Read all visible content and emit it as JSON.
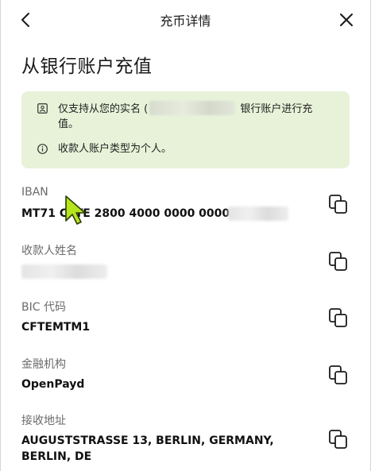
{
  "header": {
    "title": "充币详情",
    "back_icon": "chevron-left-icon",
    "close_icon": "close-icon"
  },
  "page": {
    "title": "从银行账户充值"
  },
  "notice": {
    "line1_prefix": "仅支持从您的实名 (",
    "line1_suffix": " 银行账户进行充",
    "line1_wrap": "值。",
    "line2": "收款人账户类型为个人。",
    "icon1": "id-card-icon",
    "icon2": "info-circle-icon",
    "background": "#e7f2d8"
  },
  "fields": [
    {
      "label": "IBAN",
      "value": "MT71 CFTE 2800 4000 0000 0000"
    },
    {
      "label": "收款人姓名",
      "value": ""
    },
    {
      "label": "BIC 代码",
      "value": "CFTEMTM1"
    },
    {
      "label": "金融机构",
      "value": "OpenPayd"
    },
    {
      "label": "接收地址",
      "value_line1": "AUGUSTSTRASSE 13, BERLIN, GERMANY,",
      "value_line2": "BERLIN, DE"
    }
  ],
  "icons": {
    "copy": "copy-icon",
    "cursor": "mouse-cursor-icon",
    "cursor_color": "#b5e61d"
  }
}
